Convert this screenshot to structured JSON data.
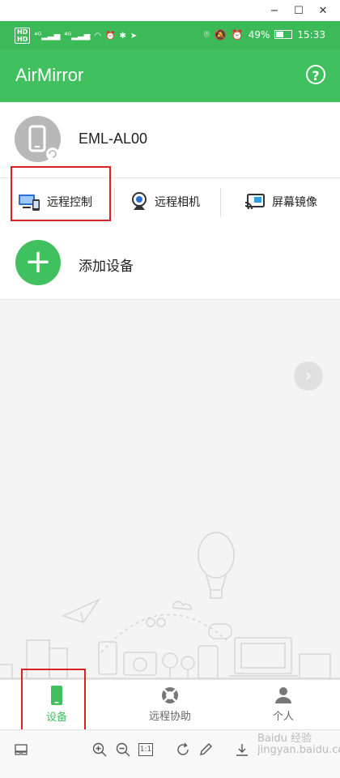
{
  "window": {
    "minimize": "−",
    "maximize": "☐",
    "close": "✕"
  },
  "status": {
    "left_indicators": "HD 4G  4G  ≋  ⏰  ✱  ✈",
    "battery": "49%",
    "time": "15:33"
  },
  "app": {
    "title": "AirMirror",
    "help_label": "?"
  },
  "device": {
    "name": "EML-AL00"
  },
  "actions": [
    {
      "label": "远程控制",
      "icon": "monitor-phone-icon"
    },
    {
      "label": "远程相机",
      "icon": "webcam-icon"
    },
    {
      "label": "屏幕镜像",
      "icon": "cast-screen-icon"
    }
  ],
  "add_device": {
    "label": "添加设备",
    "icon": "plus-icon"
  },
  "next_button": "›",
  "bottom_nav": [
    {
      "label": "设备",
      "icon": "phone-icon",
      "active": true
    },
    {
      "label": "远程协助",
      "icon": "lifebuoy-icon",
      "active": false
    },
    {
      "label": "个人",
      "icon": "person-icon",
      "active": false
    }
  ],
  "toolbar": {
    "zoom_ratio": "1:1"
  },
  "colors": {
    "brand_green": "#41c05f",
    "status_green": "#3cba58",
    "highlight_red": "#e02020"
  },
  "watermark": "Baidu 经验 jingyan.baidu.com"
}
